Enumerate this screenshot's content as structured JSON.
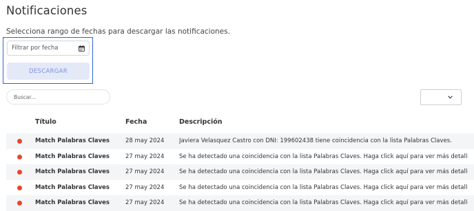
{
  "page": {
    "title": "Notificaciones",
    "subtitle": "Selecciona rango de fechas para descargar las notificaciones."
  },
  "filters": {
    "date_placeholder": "Filtrar por fecha",
    "download_label": "DESCARGAR",
    "search_placeholder": "Buscar...",
    "select_value": ""
  },
  "icons": {
    "calendar": "calendar-icon",
    "chevron": "chevron-down-icon",
    "status_dot": "status-dot"
  },
  "colors": {
    "accent_border": "#2f63d6",
    "button_bg": "#e4e9f8",
    "button_text": "#7d93d6",
    "status_dot": "#e8452c",
    "row_alt": "#f4f5f7"
  },
  "table": {
    "headers": [
      "Título",
      "Fecha",
      "Descripción"
    ],
    "rows": [
      {
        "title": "Match Palabras Claves",
        "date": "28 may 2024",
        "description": "Javiera Velasquez Castro con DNI: 199602438 tiene coincidencia con la lista Palabras Claves."
      },
      {
        "title": "Match Palabras Claves",
        "date": "27 may 2024",
        "description": "Se ha detectado una coincidencia con la lista Palabras Claves. Haga click aquí para ver más detalle"
      },
      {
        "title": "Match Palabras Claves",
        "date": "27 may 2024",
        "description": "Se ha detectado una coincidencia con la lista Palabras Claves. Haga click aquí para ver más detalle"
      },
      {
        "title": "Match Palabras Claves",
        "date": "27 may 2024",
        "description": "Se ha detectado una coincidencia con la lista Palabras Claves. Haga click aquí para ver más detalle"
      },
      {
        "title": "Match Palabras Claves",
        "date": "27 may 2024",
        "description": "Se ha detectado una coincidencia con la lista Palabras Claves. Haga click aquí para ver más detalle"
      }
    ]
  }
}
